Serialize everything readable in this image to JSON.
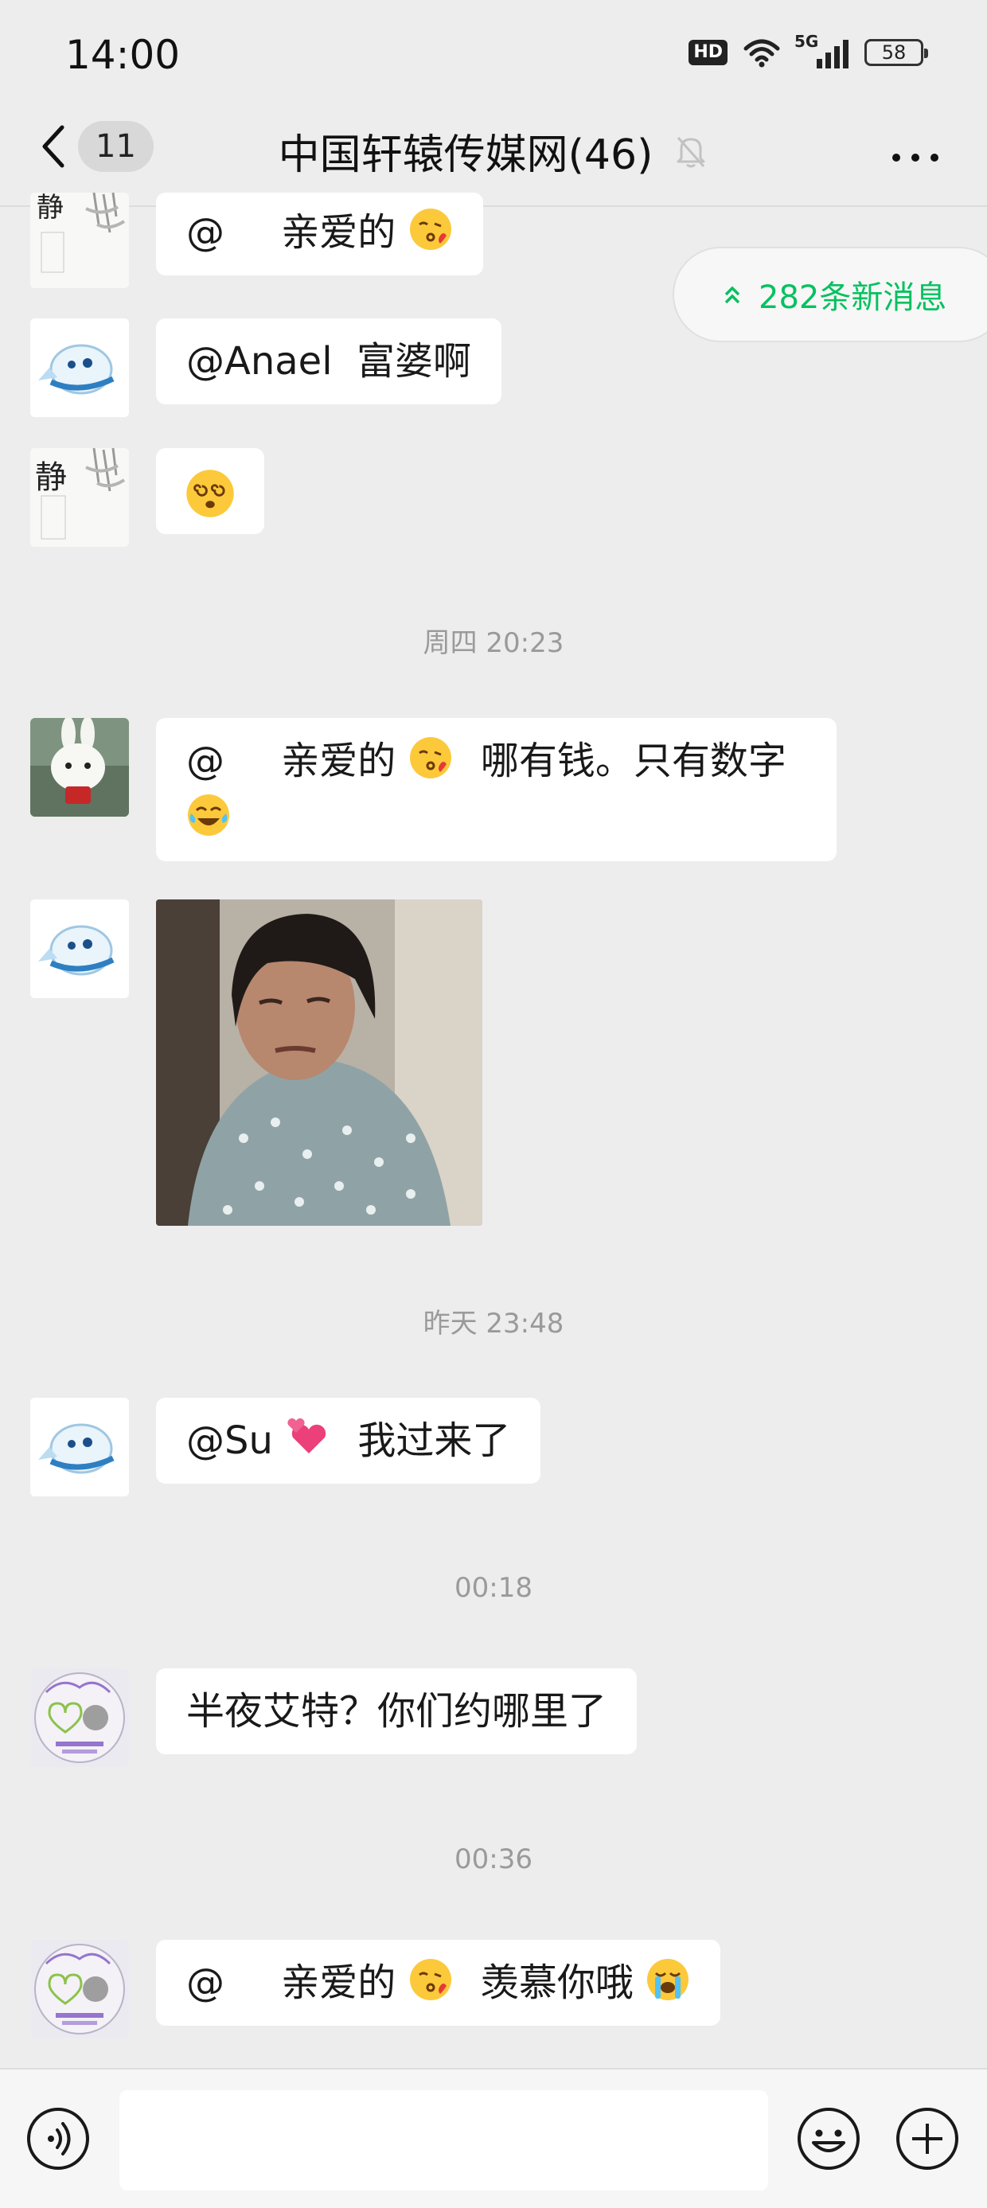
{
  "status_bar": {
    "time": "14:00",
    "hd_label": "HD",
    "network_label": "5G",
    "battery": "58"
  },
  "nav": {
    "unread_count": "11",
    "title": "中国轩辕传媒网(46)"
  },
  "new_messages_label": "282条新消息",
  "messages": [
    {
      "mention": "@",
      "text": "亲爱的"
    },
    {
      "text": "@Anael  富婆啊"
    },
    {
      "text": ""
    },
    {
      "mention": "@",
      "text": "亲爱的",
      "text2": "哪有钱。只有数字"
    },
    {
      "text": ""
    },
    {
      "text": "@Su",
      "text2": "我过来了"
    },
    {
      "text": "半夜艾特？你们约哪里了"
    },
    {
      "mention": "@",
      "text": "亲爱的",
      "text2": "羡慕你哦"
    }
  ],
  "timestamps": [
    "周四 20:23",
    "昨天 23:48",
    "00:18",
    "00:36"
  ],
  "avatar_labels": {
    "jing": "静"
  },
  "colors": {
    "accent": "#07c160",
    "background": "#ededed",
    "bubble": "#ffffff"
  },
  "icons": [
    "back-arrow-icon",
    "mute-bell-icon",
    "more-icon",
    "double-chevron-up-icon",
    "voice-icon",
    "emoji-icon",
    "plus-icon",
    "wifi-icon",
    "signal-icon"
  ]
}
